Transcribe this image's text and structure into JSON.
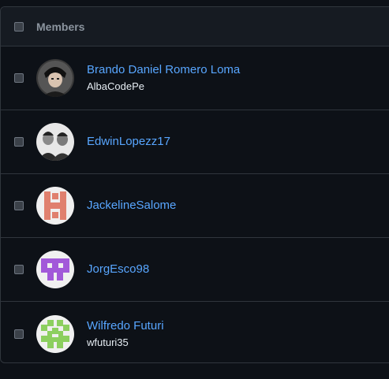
{
  "header": {
    "title": "Members"
  },
  "members": [
    {
      "name": "Brando Daniel Romero Loma",
      "login": "AlbaCodePe",
      "avatar": "anime-character-photo-avatar"
    },
    {
      "name": "EdwinLopezz17",
      "login": "",
      "avatar": "two-people-photo-avatar"
    },
    {
      "name": "JackelineSalome",
      "login": "",
      "avatar": "salmon-identicon-avatar",
      "color": "#e0806e"
    },
    {
      "name": "JorgEsco98",
      "login": "",
      "avatar": "purple-identicon-avatar",
      "color": "#a259d9"
    },
    {
      "name": "Wilfredo Futuri",
      "login": "wfuturi35",
      "avatar": "green-identicon-avatar",
      "color": "#8ccf5f"
    }
  ]
}
